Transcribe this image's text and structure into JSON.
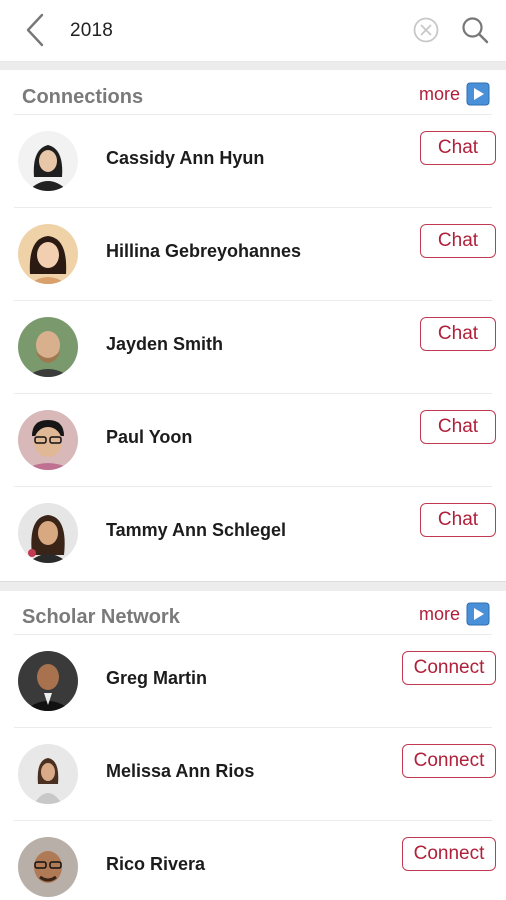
{
  "header": {
    "query": "2018",
    "clear_icon": "clear-circle-icon",
    "search_icon": "search-icon",
    "back_icon": "chevron-left-icon"
  },
  "colors": {
    "accent": "#b0203a",
    "section_title": "#7a7a7a",
    "more_icon": "#4a90d9"
  },
  "connections": {
    "title": "Connections",
    "more_label": "more",
    "items": [
      {
        "name": "Cassidy Ann Hyun",
        "action": "Chat"
      },
      {
        "name": "Hillina Gebreyohannes",
        "action": "Chat"
      },
      {
        "name": "Jayden Smith",
        "action": "Chat"
      },
      {
        "name": "Paul Yoon",
        "action": "Chat"
      },
      {
        "name": "Tammy Ann Schlegel",
        "action": "Chat"
      }
    ]
  },
  "scholar_network": {
    "title": "Scholar Network",
    "more_label": "more",
    "items": [
      {
        "name": "Greg Martin",
        "action": "Connect"
      },
      {
        "name": "Melissa Ann Rios",
        "action": "Connect"
      },
      {
        "name": "Rico Rivera",
        "action": "Connect"
      }
    ]
  }
}
